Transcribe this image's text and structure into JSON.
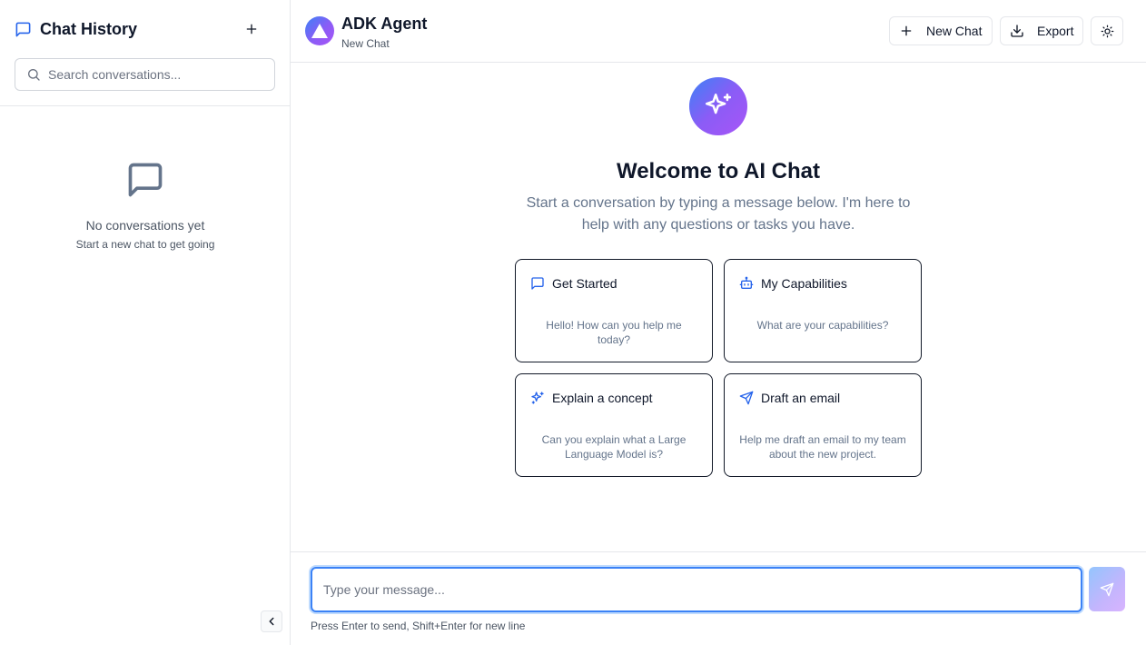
{
  "sidebar": {
    "title": "Chat History",
    "title_icon": "message-square-icon",
    "new_icon": "plus-icon",
    "search": {
      "placeholder": "Search conversations...",
      "value": "",
      "icon": "search-icon"
    },
    "empty": {
      "icon": "message-square-icon",
      "title": "No conversations yet",
      "subtitle": "Start a new chat to get going"
    },
    "collapse_icon": "chevron-left-icon"
  },
  "header": {
    "agent_name": "ADK Agent",
    "agent_subtitle": "New Chat",
    "new_chat_label": "New Chat",
    "export_label": "Export",
    "theme_icon": "sun-icon"
  },
  "welcome": {
    "icon": "sparkles-icon",
    "title": "Welcome to AI Chat",
    "subtitle": "Start a conversation by typing a message below. I'm here to help with any questions or tasks you have."
  },
  "suggestions": [
    {
      "title": "Get Started",
      "description": "Hello! How can you help me today?",
      "icon": "message-square-icon"
    },
    {
      "title": "My Capabilities",
      "description": "What are your capabilities?",
      "icon": "bot-icon"
    },
    {
      "title": "Explain a concept",
      "description": "Can you explain what a Large Language Model is?",
      "icon": "sparkles-icon"
    },
    {
      "title": "Draft an email",
      "description": "Help me draft an email to my team about the new project.",
      "icon": "send-icon"
    }
  ],
  "composer": {
    "placeholder": "Type your message...",
    "value": "",
    "hint": "Press Enter to send, Shift+Enter for new line",
    "send_icon": "send-icon"
  },
  "colors": {
    "accent": "#3b82f6",
    "gradient_start": "#3b82f6",
    "gradient_end": "#a855f7",
    "muted_text": "#64748b",
    "border": "#e5e7eb"
  }
}
